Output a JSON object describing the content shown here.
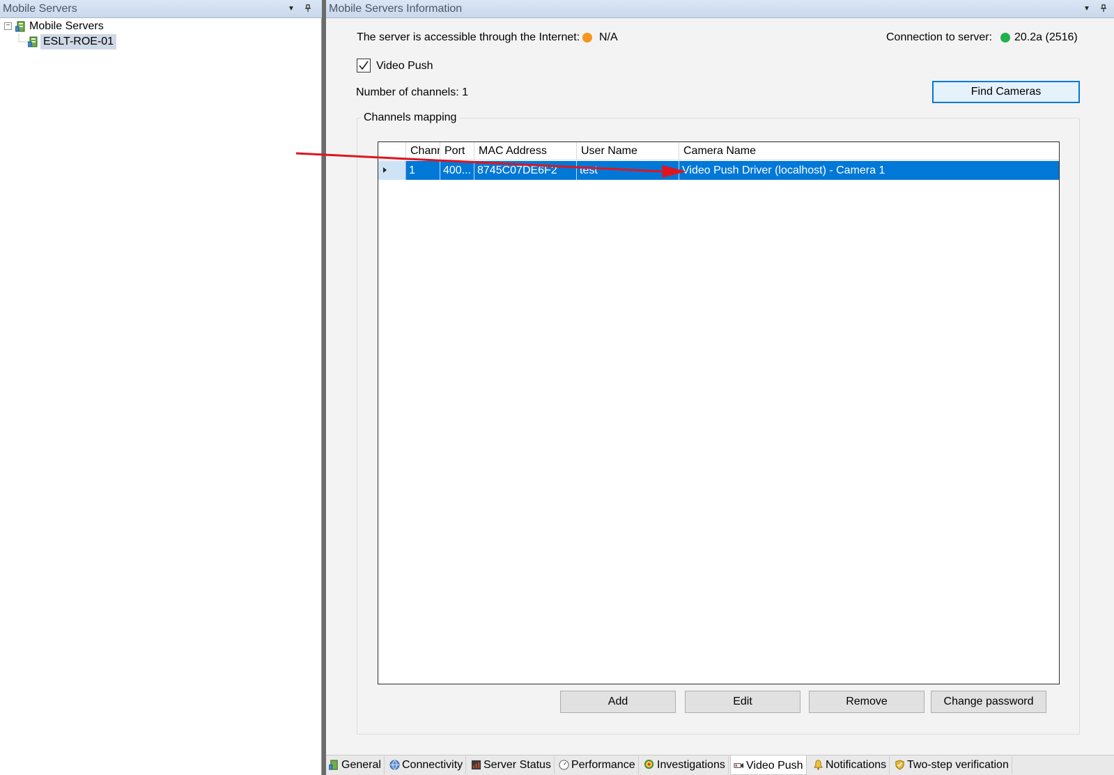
{
  "left_pane": {
    "title": "Mobile Servers",
    "dropdown_glyph": "▼",
    "pin_glyph": "📌",
    "tree": {
      "root_label": "Mobile Servers",
      "expander_glyph": "−",
      "children": [
        {
          "label": "ESLT-ROE-01"
        }
      ]
    }
  },
  "right_pane": {
    "title": "Mobile Servers Information",
    "internet_label": "The server is accessible through the Internet:",
    "internet_status": "N/A",
    "internet_status_color": "#f7941d",
    "connection_label": "Connection to server:",
    "connection_value": "20.2a (2516)",
    "connection_status_color": "#22b14c",
    "video_push_checkbox": {
      "label": "Video Push",
      "checked": true
    },
    "channels_count_label": "Number of channels: 1",
    "find_cameras_button": "Find Cameras",
    "channels_group_title": "Channels mapping",
    "grid": {
      "columns": [
        "Channel",
        "Port",
        "MAC Address",
        "User Name",
        "Camera Name"
      ],
      "rows": [
        {
          "channel": "1",
          "port": "400...",
          "mac": "8745C07DE6F2",
          "user": "test",
          "camera": "Video Push Driver (localhost) - Camera 1"
        }
      ],
      "selection_color": "#0078d7"
    },
    "buttons": {
      "add": "Add",
      "edit": "Edit",
      "remove": "Remove",
      "change_password": "Change password"
    },
    "tabs": [
      {
        "label": "General",
        "icon": "server-icon"
      },
      {
        "label": "Connectivity",
        "icon": "globe-icon"
      },
      {
        "label": "Server Status",
        "icon": "monitor-icon"
      },
      {
        "label": "Performance",
        "icon": "gauge-icon"
      },
      {
        "label": "Investigations",
        "icon": "investigation-icon"
      },
      {
        "label": "Video Push",
        "icon": "camera-icon",
        "active": true
      },
      {
        "label": "Notifications",
        "icon": "bell-icon"
      },
      {
        "label": "Two-step verification",
        "icon": "shield-icon"
      }
    ]
  },
  "annotation": {
    "arrow_color": "#e0141e"
  }
}
